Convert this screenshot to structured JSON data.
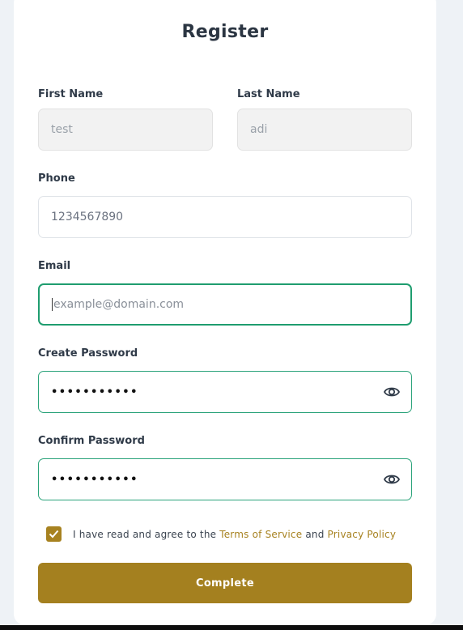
{
  "title": "Register",
  "fields": {
    "first_name": {
      "label": "First Name",
      "value": "test"
    },
    "last_name": {
      "label": "Last Name",
      "value": "adi"
    },
    "phone": {
      "label": "Phone",
      "value": "1234567890"
    },
    "email": {
      "label": "Email",
      "placeholder": "example@domain.com"
    },
    "create_password": {
      "label": "Create Password",
      "masked": "•••••••••••"
    },
    "confirm_password": {
      "label": "Confirm Password",
      "masked": "•••••••••••"
    }
  },
  "terms": {
    "checked": true,
    "prefix": "I have read and agree to the ",
    "tos": "Terms of Service",
    "and": " and ",
    "privacy": "Privacy Policy"
  },
  "submit_label": "Complete",
  "colors": {
    "accent": "#a4801f",
    "focus_border": "#1f9d6f"
  },
  "icons": {
    "password_toggle": "eye-icon",
    "checkbox": "checkmark-icon"
  }
}
